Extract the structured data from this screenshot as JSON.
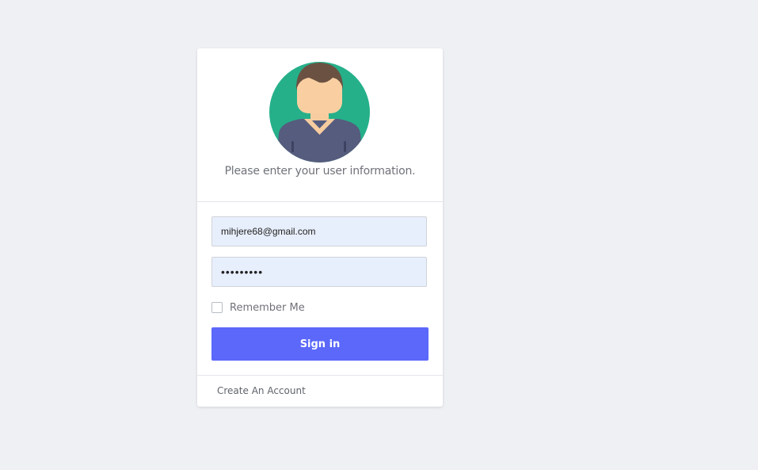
{
  "login": {
    "subtitle": "Please enter your user information.",
    "email_value": "mihjere68@gmail.com",
    "password_value": "•••••••••",
    "remember_label": "Remember Me",
    "remember_checked": false,
    "signin_label": "Sign in",
    "create_account_label": "Create An Account"
  },
  "colors": {
    "background": "#eef0f4",
    "primary_button": "#5b68fa",
    "avatar_circle": "#25b08a",
    "input_fill": "#e8effc"
  },
  "icons": {
    "avatar": "user-avatar-icon"
  }
}
